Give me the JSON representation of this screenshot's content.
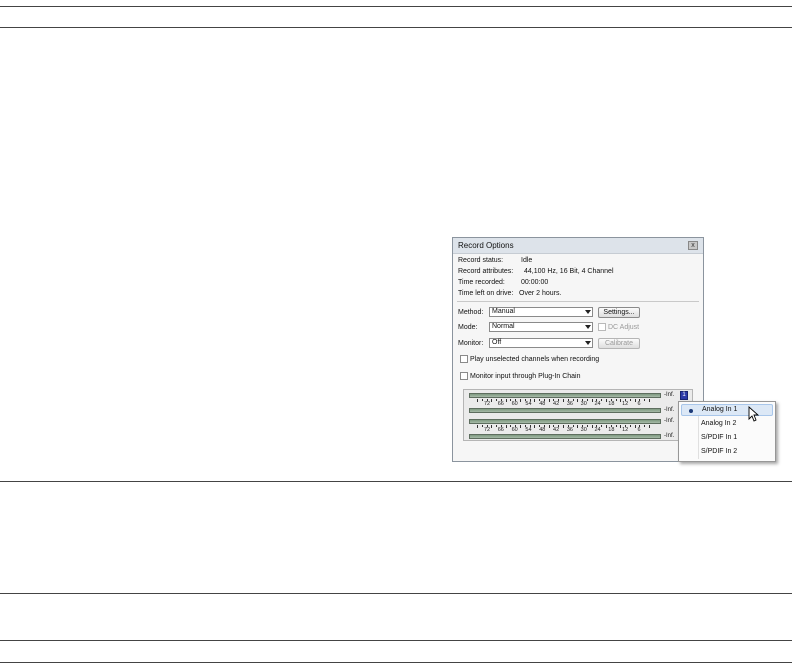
{
  "dialog": {
    "title": "Record Options",
    "close_label": "x",
    "info": [
      {
        "label": "Record status:",
        "value": "Idle"
      },
      {
        "label": "Record attributes:",
        "value": "44,100 Hz, 16 Bit, 4 Channel"
      },
      {
        "label": "Time recorded:",
        "value": "00:00:00"
      },
      {
        "label": "Time left on drive:",
        "value": "Over 2 hours."
      }
    ],
    "method": {
      "label": "Method:",
      "value": "Manual",
      "button": "Settings..."
    },
    "mode": {
      "label": "Mode:",
      "value": "Normal",
      "checkbox": "DC Adjust"
    },
    "monitor": {
      "label": "Monitor:",
      "value": "Off",
      "button": "Calibrate"
    },
    "checkboxes": [
      "Play unselected channels when recording",
      "Monitor input through Plug-In Chain"
    ],
    "meters": {
      "scale": [
        "72",
        "66",
        "60",
        "54",
        "48",
        "42",
        "36",
        "30",
        "24",
        "18",
        "12",
        "6"
      ],
      "inf_label": "-Inf.",
      "channel_buttons": [
        "1",
        "",
        "",
        ""
      ]
    }
  },
  "dropdown": {
    "items": [
      "Analog In 1",
      "Analog In 2",
      "S/PDIF In 1",
      "S/PDIF In 2"
    ],
    "selected_index": 0
  },
  "colors": {
    "channel_blue": "#2d3aa8",
    "channel_pink": "#d64aa0",
    "meter_green": "#8fa891"
  }
}
